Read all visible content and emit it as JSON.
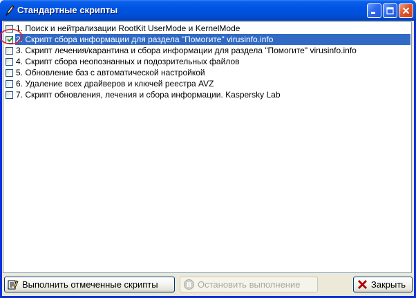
{
  "window": {
    "title": "Стандартные скрипты"
  },
  "scripts": [
    {
      "label": "1. Поиск и нейтрализации RootKit UserMode и KernelMode",
      "checked": false,
      "selected": false
    },
    {
      "label": "2. Скрипт сбора информации для раздела \"Помогите\" virusinfo.info",
      "checked": true,
      "selected": true
    },
    {
      "label": "3. Скрипт лечения/карантина и сбора информации для раздела \"Помогите\" virusinfo.info",
      "checked": false,
      "selected": false
    },
    {
      "label": "4. Скрипт сбора неопознанных и подозрительных файлов",
      "checked": false,
      "selected": false
    },
    {
      "label": "5. Обновление баз с автоматической настройкой",
      "checked": false,
      "selected": false
    },
    {
      "label": "6. Удаление всех драйверов и ключей реестра AVZ",
      "checked": false,
      "selected": false
    },
    {
      "label": "7. Скрипт обновления, лечения и сбора информации. Kaspersky Lab",
      "checked": false,
      "selected": false
    }
  ],
  "buttons": {
    "run_label": "Выполнить отмеченные скрипты",
    "stop_label": "Остановить выполнение",
    "close_label": "Закрыть"
  },
  "colors": {
    "selection": "#316AC5",
    "titlebar": "#0054E3",
    "annotation_circle": "#E0202A"
  },
  "icons": {
    "title": "pen-icon",
    "run": "run-scripts-icon",
    "stop": "stop-icon",
    "close": "close-x-icon"
  }
}
